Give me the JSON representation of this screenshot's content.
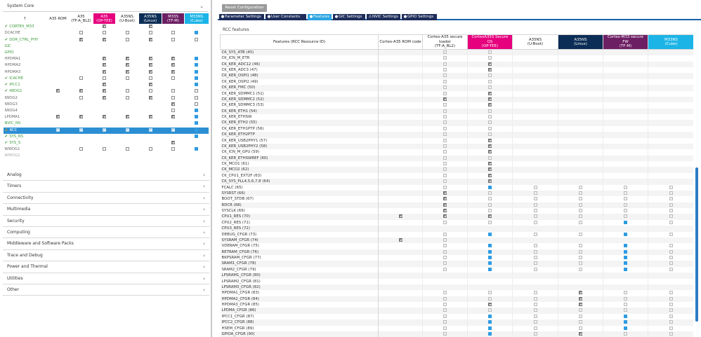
{
  "left_panel": {
    "system_core_label": "System Core",
    "columns": [
      "",
      "A35 ROM",
      "A35\n(TF-A_BL2)",
      "A35\n(OP-TEE)",
      "A35NS\n(U-Boot)",
      "A35NS\n(Linux)",
      "M33S\n(TF-M)",
      "M33NS\n(Cube)"
    ],
    "rows": [
      {
        "name": "CORTEX_M33",
        "mark": "ok",
        "color": "green",
        "v": [
          "",
          "",
          "on",
          "",
          "on",
          "",
          ""
        ]
      },
      {
        "name": "DCACHE",
        "mark": "",
        "color": "default",
        "v": [
          "",
          "off",
          "off",
          "off",
          "off",
          "off",
          "on"
        ]
      },
      {
        "name": "DDR_CTRL_PHY",
        "mark": "ok",
        "color": "green",
        "v": [
          "",
          "on",
          "on",
          "off",
          "on",
          "off",
          "off"
        ]
      },
      {
        "name": "GIC",
        "mark": "",
        "color": "green",
        "v": [
          "",
          "",
          "",
          "",
          "",
          "",
          ""
        ]
      },
      {
        "name": "GPIO",
        "mark": "",
        "color": "green",
        "v": [
          "",
          "",
          "",
          "",
          "",
          "",
          ""
        ]
      },
      {
        "name": "HPDMA1",
        "mark": "",
        "color": "default",
        "v": [
          "",
          "",
          "on",
          "on",
          "on",
          "on",
          "on"
        ]
      },
      {
        "name": "HPDMA2",
        "mark": "",
        "color": "default",
        "v": [
          "",
          "",
          "on",
          "on",
          "on",
          "on",
          "on"
        ]
      },
      {
        "name": "HPDMA3",
        "mark": "",
        "color": "default",
        "v": [
          "",
          "",
          "on",
          "on",
          "on",
          "on",
          "on"
        ]
      },
      {
        "name": "ICACHE",
        "mark": "ok",
        "color": "green",
        "v": [
          "",
          "off",
          "off",
          "off",
          "off",
          "off",
          "on"
        ]
      },
      {
        "name": "IPCC1",
        "mark": "ok",
        "color": "green",
        "v": [
          "",
          "",
          "on",
          "",
          "on",
          "",
          "on"
        ]
      },
      {
        "name": "IWDG1",
        "mark": "ok",
        "color": "green",
        "v": [
          "on",
          "on",
          "on",
          "off",
          "off",
          "off",
          "off"
        ]
      },
      {
        "name": "IWDG2",
        "mark": "",
        "color": "default",
        "v": [
          "",
          "off",
          "on",
          "off",
          "on",
          "off",
          "off"
        ]
      },
      {
        "name": "IWDG3",
        "mark": "",
        "color": "default",
        "v": [
          "",
          "",
          "",
          "",
          "",
          "on",
          "off"
        ]
      },
      {
        "name": "IWDG4",
        "mark": "",
        "color": "default",
        "v": [
          "",
          "",
          "",
          "",
          "",
          "off",
          "on"
        ]
      },
      {
        "name": "LPDMA1",
        "mark": "",
        "color": "default",
        "v": [
          "on",
          "on",
          "on",
          "on",
          "on",
          "on",
          "on"
        ]
      },
      {
        "name": "NVIC_NS",
        "mark": "",
        "color": "green",
        "v": [
          "",
          "",
          "",
          "",
          "",
          "",
          "on"
        ]
      },
      {
        "name": "RCC",
        "mark": "warn",
        "color": "default",
        "v": [
          "on",
          "on",
          "on",
          "on",
          "on",
          "on",
          "on"
        ]
      },
      {
        "name": "SYS_NS",
        "mark": "ok",
        "color": "green",
        "v": [
          "",
          "",
          "",
          "",
          "",
          "",
          "on"
        ]
      },
      {
        "name": "SYS_S",
        "mark": "ok",
        "color": "green",
        "v": [
          "",
          "",
          "",
          "",
          "",
          "on",
          ""
        ]
      },
      {
        "name": "WWDG1",
        "mark": "",
        "color": "default",
        "v": [
          "",
          "off",
          "off",
          "off",
          "off",
          "off",
          "on"
        ]
      },
      {
        "name": "WWDG2",
        "mark": "",
        "color": "grey",
        "v": [
          "",
          "",
          "",
          "",
          "",
          "",
          ""
        ]
      }
    ],
    "sections": [
      "Analog",
      "Timers",
      "Connectivity",
      "Multimedia",
      "Security",
      "Computing",
      "Middleware and Software Packs",
      "Trace and Debug",
      "Power and Thermal",
      "Utilities",
      "Other"
    ]
  },
  "right_panel": {
    "reset_label": "Reset Configuration",
    "tabs": [
      {
        "icon": "●",
        "label": "Parameter Settings"
      },
      {
        "icon": "●",
        "label": "User Constants"
      },
      {
        "icon": "●",
        "label": "Features"
      },
      {
        "icon": "●",
        "label": "GIC Settings"
      },
      {
        "icon": "⚠",
        "label": "NVIC Settings"
      },
      {
        "icon": "●",
        "label": "GPIO Settings"
      }
    ],
    "features_title": "RCC features",
    "columns": [
      "Features (RCC Resource ID)",
      "Cortex-A35 ROM code",
      "Cortex-A35 secure loader\n(TF-A_BL2)",
      "CortexA35S Secure OS\n(OP-TEE)",
      "A35NS\n(U-Boot)",
      "A35NS\n(Linux)",
      "Cortex-M33 secure FW\n(TF-M)",
      "M33NS\n(Cube)"
    ],
    "rows": [
      {
        "name": "CK_SYS_ATB (45)",
        "v": "0000000"
      },
      {
        "name": "CK_ICN_M_ETR",
        "v": "0000000"
      },
      {
        "name": "CK_KER_ADC12 (46)",
        "v": "0010000"
      },
      {
        "name": "CK_KER_ADC3 (47)",
        "v": "0010000"
      },
      {
        "name": "CK_KER_OSPI1 (48)",
        "v": "0000000"
      },
      {
        "name": "CK_KER_OSPI2 (49)",
        "v": "0000000"
      },
      {
        "name": "CK_KER_FMC (50)",
        "v": "0000000"
      },
      {
        "name": "CK_KER_SDMMC1 (51)",
        "v": "0010000"
      },
      {
        "name": "CK_KER_SDMMC2 (52)",
        "v": "0110000"
      },
      {
        "name": "CK_KER_SDMMC3 (53)",
        "v": "0010000"
      },
      {
        "name": "CK_KER_ETH1 (54)",
        "v": "0000000"
      },
      {
        "name": "CK_KER_ETHSW",
        "v": "0000000"
      },
      {
        "name": "CK_KER_ETH2 (55)",
        "v": "0000000"
      },
      {
        "name": "CK_KER_ETH1PTP (56)",
        "v": "0000000"
      },
      {
        "name": "CK_KER_ETH2PTP",
        "v": "0000000"
      },
      {
        "name": "CK_KER_USB2PHY1 (57)",
        "v": "0010000"
      },
      {
        "name": "CK_KER_USB2PHY2 (58)",
        "v": "0010000"
      },
      {
        "name": "CK_ICN_M_GPU (59)",
        "v": "0010000"
      },
      {
        "name": "CK_KER_ETHSWREF (60)",
        "v": "0000000"
      },
      {
        "name": "CK_MCO1 (61)",
        "v": "0010000"
      },
      {
        "name": "CK_MCO2 (62)",
        "v": "0010000"
      },
      {
        "name": "CK_CPU1_EXT2F (63)",
        "v": "0010000"
      },
      {
        "name": "CK_SYS_PLL4,5,6,7,8 (64)",
        "v": "0010000"
      },
      {
        "name": "FCALC (65)",
        "v": "0030000"
      },
      {
        "name": "SYSRST (66)",
        "v": "0100000"
      },
      {
        "name": "BOOT_STDB (67)",
        "v": "0100000"
      },
      {
        "name": "RDCR (68)",
        "v": "0100000"
      },
      {
        "name": "SYSCLK (69)",
        "v": "0100000"
      },
      {
        "name": "CPU1_RES (70)",
        "v": "1110000"
      },
      {
        "name": "CPU2_RES (71)",
        "v": "0000030"
      },
      {
        "name": "CPU3_RES (72)",
        "v": "0000000"
      },
      {
        "name": "DEBUG_CFGR (73)",
        "v": "0030030"
      },
      {
        "name": "SYSRAM_CFGR (74)",
        "v": "1000000"
      },
      {
        "name": "VDERAM_CFGR (75)",
        "v": "0030030"
      },
      {
        "name": "RETRAM_CFGR (76)",
        "v": "0030030"
      },
      {
        "name": "BKPSRAM_CFGR (77)",
        "v": "0030030"
      },
      {
        "name": "SRAM1_CFGR (78)",
        "v": "0030030"
      },
      {
        "name": "SRAM2_CFGR (79)",
        "v": "0030030"
      },
      {
        "name": "LPSRAM1_CFGR (80)",
        "v": "0000000"
      },
      {
        "name": "LPSRAM2_CFGR (81)",
        "v": "0000000"
      },
      {
        "name": "LPSRAM3_CFGR (82)",
        "v": "0000000"
      },
      {
        "name": "HPDMA1_CFGR (83)",
        "v": "0000100"
      },
      {
        "name": "HPDMA2_CFGR (84)",
        "v": "0000100"
      },
      {
        "name": "HPDMA3_CFGR (85)",
        "v": "0010100"
      },
      {
        "name": "LPDMA_CFGR (86)",
        "v": "0000000"
      },
      {
        "name": "IPCC1_CFGR (87)",
        "v": "0030030"
      },
      {
        "name": "IPCC2_CFGR (88)",
        "v": "0030030"
      },
      {
        "name": "HSEM_CFGR (89)",
        "v": "0030030"
      },
      {
        "name": "GPIOA_CFGR (90)",
        "v": "0030100"
      }
    ],
    "present_mask": [
      "0110000",
      "0110000",
      "0110000",
      "0110000",
      "0110000",
      "0110000",
      "0110000",
      "0110000",
      "0110000",
      "0110000",
      "0110000",
      "0110000",
      "0110000",
      "0110000",
      "0110000",
      "0110000",
      "0110000",
      "0110000",
      "0110000",
      "0110000",
      "0110000",
      "0110000",
      "0110000",
      "0111111",
      "0111111",
      "0111111",
      "0111111",
      "0111111",
      "1111111",
      "0111111",
      "0000000",
      "0111111",
      "1100000",
      "0111111",
      "0111111",
      "0111111",
      "0111111",
      "0111111",
      "0000000",
      "0000000",
      "0000000",
      "0111111",
      "0111111",
      "0111111",
      "0111111",
      "0111111",
      "0111111",
      "0111111",
      "0111111"
    ]
  },
  "colors": {
    "op_tee": "#e6007e",
    "linux": "#0c2d55",
    "tf_m": "#6d1f64",
    "cube": "#1cb4e6",
    "selected_row": "#2d8fd3",
    "tab": "#1e2d59",
    "tab_active": "#2ba4e0"
  }
}
